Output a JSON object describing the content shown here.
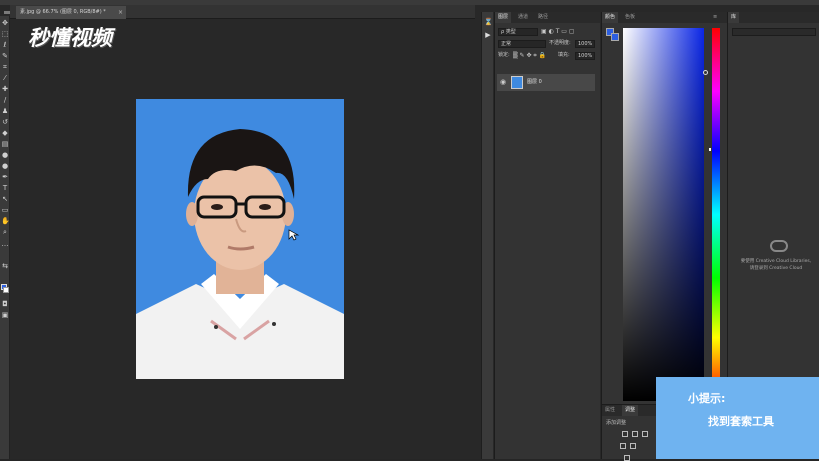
{
  "document": {
    "tab_label": "素.jpg @ 66.7% (图层 0, RGB/8#) *",
    "close_glyph": "×"
  },
  "logo": {
    "text": "秒懂视频"
  },
  "layers_panel": {
    "tabs": [
      "图层",
      "通道",
      "路径"
    ],
    "filter_label": "ρ 类型",
    "blend_mode": "正常",
    "opacity_label": "不透明度:",
    "opacity_value": "100%",
    "lock_label": "锁定:",
    "fill_label": "填充:",
    "fill_value": "100%",
    "layer_name": "图层 0",
    "eye_glyph": "◉"
  },
  "color_panel": {
    "tabs": [
      "颜色",
      "色板"
    ],
    "foreground_color": "#2d5fe0",
    "picker_hue": "#0a26e6"
  },
  "adjust_panel": {
    "tabs": [
      "属性",
      "调整"
    ],
    "label": "添加调整"
  },
  "library_panel": {
    "tab": "库",
    "message_line1": "要使用 Creative Cloud Libraries,",
    "message_line2": "请登录到 Creative Cloud"
  },
  "tip": {
    "title": "小提示:",
    "body": "找到套索工具"
  },
  "toolbar": {
    "tools": [
      "move-tool",
      "marquee-tool",
      "lasso-tool",
      "quick-select-tool",
      "crop-tool",
      "eyedropper-tool",
      "healing-tool",
      "brush-tool",
      "stamp-tool",
      "history-brush-tool",
      "eraser-tool",
      "gradient-tool",
      "blur-tool",
      "dodge-tool",
      "pen-tool",
      "type-tool",
      "path-select-tool",
      "shape-tool",
      "hand-tool",
      "zoom-tool"
    ]
  }
}
